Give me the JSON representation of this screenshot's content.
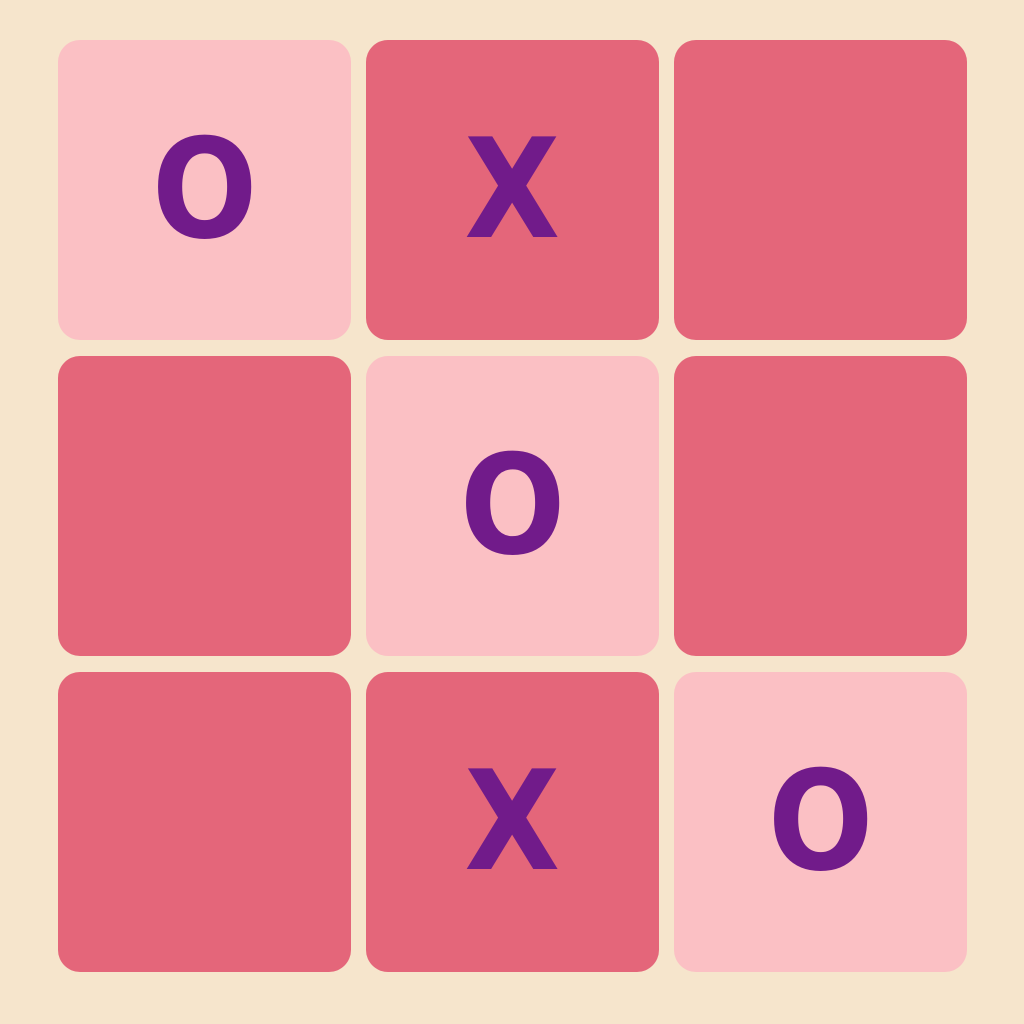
{
  "board": {
    "cells": [
      {
        "mark": "O",
        "highlighted": true
      },
      {
        "mark": "X",
        "highlighted": false
      },
      {
        "mark": "",
        "highlighted": false
      },
      {
        "mark": "",
        "highlighted": false
      },
      {
        "mark": "O",
        "highlighted": true
      },
      {
        "mark": "",
        "highlighted": false
      },
      {
        "mark": "",
        "highlighted": false
      },
      {
        "mark": "X",
        "highlighted": false
      },
      {
        "mark": "O",
        "highlighted": true
      }
    ]
  },
  "colors": {
    "background": "#f6e5cc",
    "cell": "#e4667a",
    "highlight_cell": "#fbc0c4",
    "mark": "#711b8a"
  }
}
